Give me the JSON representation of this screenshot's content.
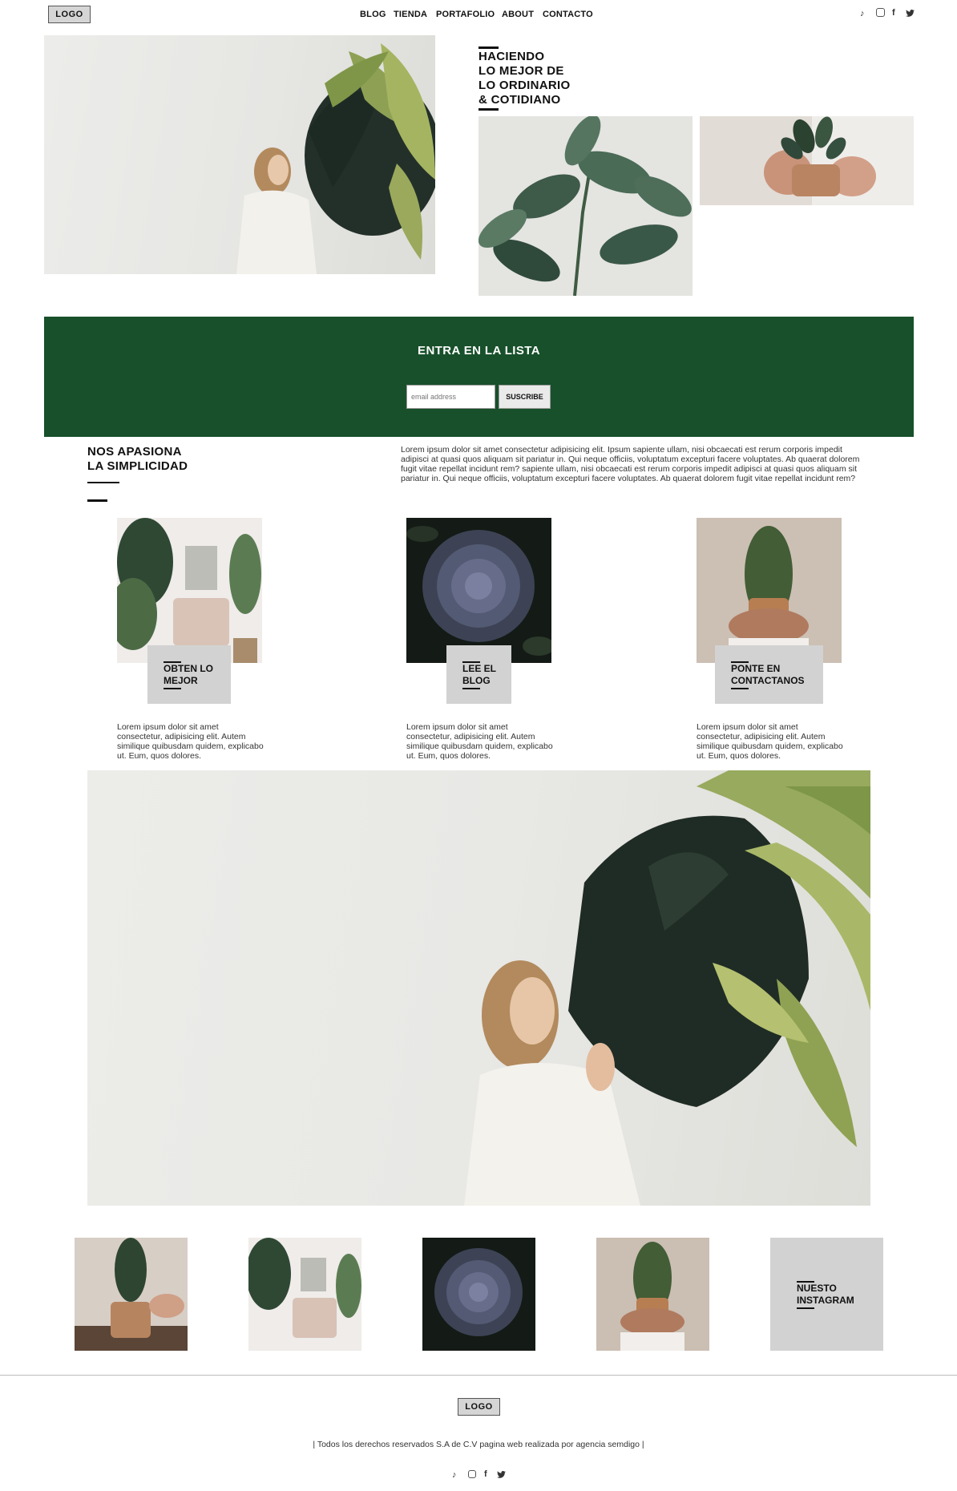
{
  "header": {
    "logo": "LOGO",
    "nav": [
      "BLOG",
      "TIENDA",
      "PORTAFOLIO",
      "ABOUT",
      "CONTACTO"
    ],
    "social_icons": [
      "tiktok-icon",
      "instagram-icon",
      "facebook-icon",
      "twitter-icon"
    ]
  },
  "hero": {
    "heading_lines": [
      "HACIENDO",
      "LO MEJOR DE",
      "LO ORDINARIO",
      "& COTIDIANO"
    ]
  },
  "newsletter": {
    "title": "ENTRA EN LA LISTA",
    "email_placeholder": "email address",
    "button": "SUSCRIBE",
    "background": "#17502a"
  },
  "about": {
    "heading_lines": [
      "NOS APASIONA",
      "LA SIMPLICIDAD"
    ],
    "body": "Lorem ipsum dolor sit amet consectetur adipisicing elit. Ipsum sapiente ullam, nisi obcaecati est rerum corporis impedit adipisci at quasi quos aliquam sit pariatur in. Qui neque officiis, voluptatum excepturi facere voluptates. Ab quaerat dolorem fugit vitae repellat incidunt rem? sapiente ullam, nisi obcaecati est rerum corporis impedit adipisci at quasi quos aliquam sit pariatur in. Qui neque officiis, voluptatum excepturi facere voluptates. Ab quaerat dolorem fugit vitae repellat incidunt rem?"
  },
  "cards": [
    {
      "label_lines": [
        "OBTEN LO",
        "MEJOR"
      ],
      "text": "Lorem ipsum dolor sit amet consectetur, adipisicing elit. Autem similique quibusdam quidem, explicabo ut. Eum, quos dolores."
    },
    {
      "label_lines": [
        "LEE EL",
        "BLOG"
      ],
      "text": "Lorem ipsum dolor sit amet consectetur, adipisicing elit. Autem similique quibusdam quidem, explicabo ut. Eum, quos dolores."
    },
    {
      "label_lines": [
        "PONTE EN",
        "CONTACTANOS"
      ],
      "text": "Lorem ipsum dolor sit amet consectetur, adipisicing elit. Autem similique quibusdam quidem, explicabo ut. Eum, quos dolores."
    }
  ],
  "instagram": {
    "label_lines": [
      "NUESTO",
      "INSTAGRAM"
    ]
  },
  "footer": {
    "logo": "LOGO",
    "copyright": "| Todos los derechos reservados S.A de C.V pagina web realizada por agencia semdigo |",
    "social_icons": [
      "tiktok-icon",
      "instagram-icon",
      "facebook-icon",
      "twitter-icon"
    ]
  }
}
